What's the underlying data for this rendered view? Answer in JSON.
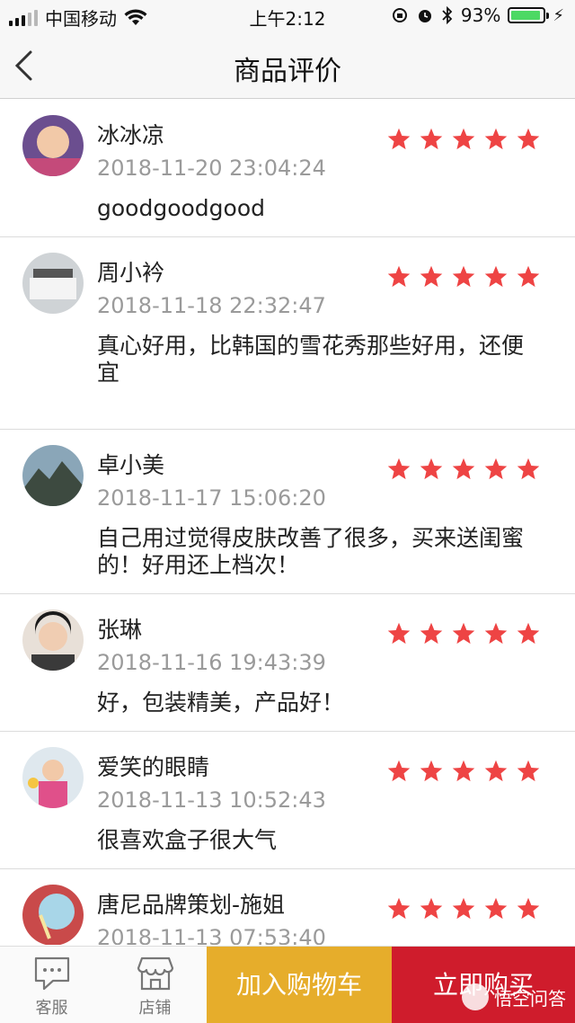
{
  "status_bar": {
    "carrier": "中国移动",
    "time": "上午2:12",
    "battery_percent": "93%",
    "battery_level": 0.93
  },
  "nav": {
    "back_icon": "chevron-left-icon",
    "title": "商品评价"
  },
  "rating_color": "#ee4444",
  "reviews": [
    {
      "name": "冰冰凉",
      "date": "2018-11-20 23:04:24",
      "content": "goodgoodgood",
      "rating": 5
    },
    {
      "name": "周小衿",
      "date": "2018-11-18 22:32:47",
      "content": "真心好用，比韩国的雪花秀那些好用，还便宜",
      "rating": 5
    },
    {
      "name": "卓小美",
      "date": "2018-11-17 15:06:20",
      "content": "自己用过觉得皮肤改善了很多，买来送闺蜜的！好用还上档次！",
      "rating": 5
    },
    {
      "name": "张琳",
      "date": "2018-11-16 19:43:39",
      "content": "好，包装精美，产品好！",
      "rating": 5
    },
    {
      "name": "爱笑的眼睛",
      "date": "2018-11-13 10:52:43",
      "content": "很喜欢盒子很大气",
      "rating": 5
    },
    {
      "name": "唐尼品牌策划-施姐",
      "date": "2018-11-13 07:53:40",
      "content": "",
      "rating": 5
    }
  ],
  "bottom_bar": {
    "service_label": "客服",
    "service_icon": "chat-bubble-icon",
    "store_label": "店铺",
    "store_icon": "store-icon",
    "cart_button": "加入购物车",
    "buy_button": "立即购买",
    "cart_color": "#e6ad2b",
    "buy_color": "#cf1c2c"
  },
  "watermark": "悟空问答"
}
